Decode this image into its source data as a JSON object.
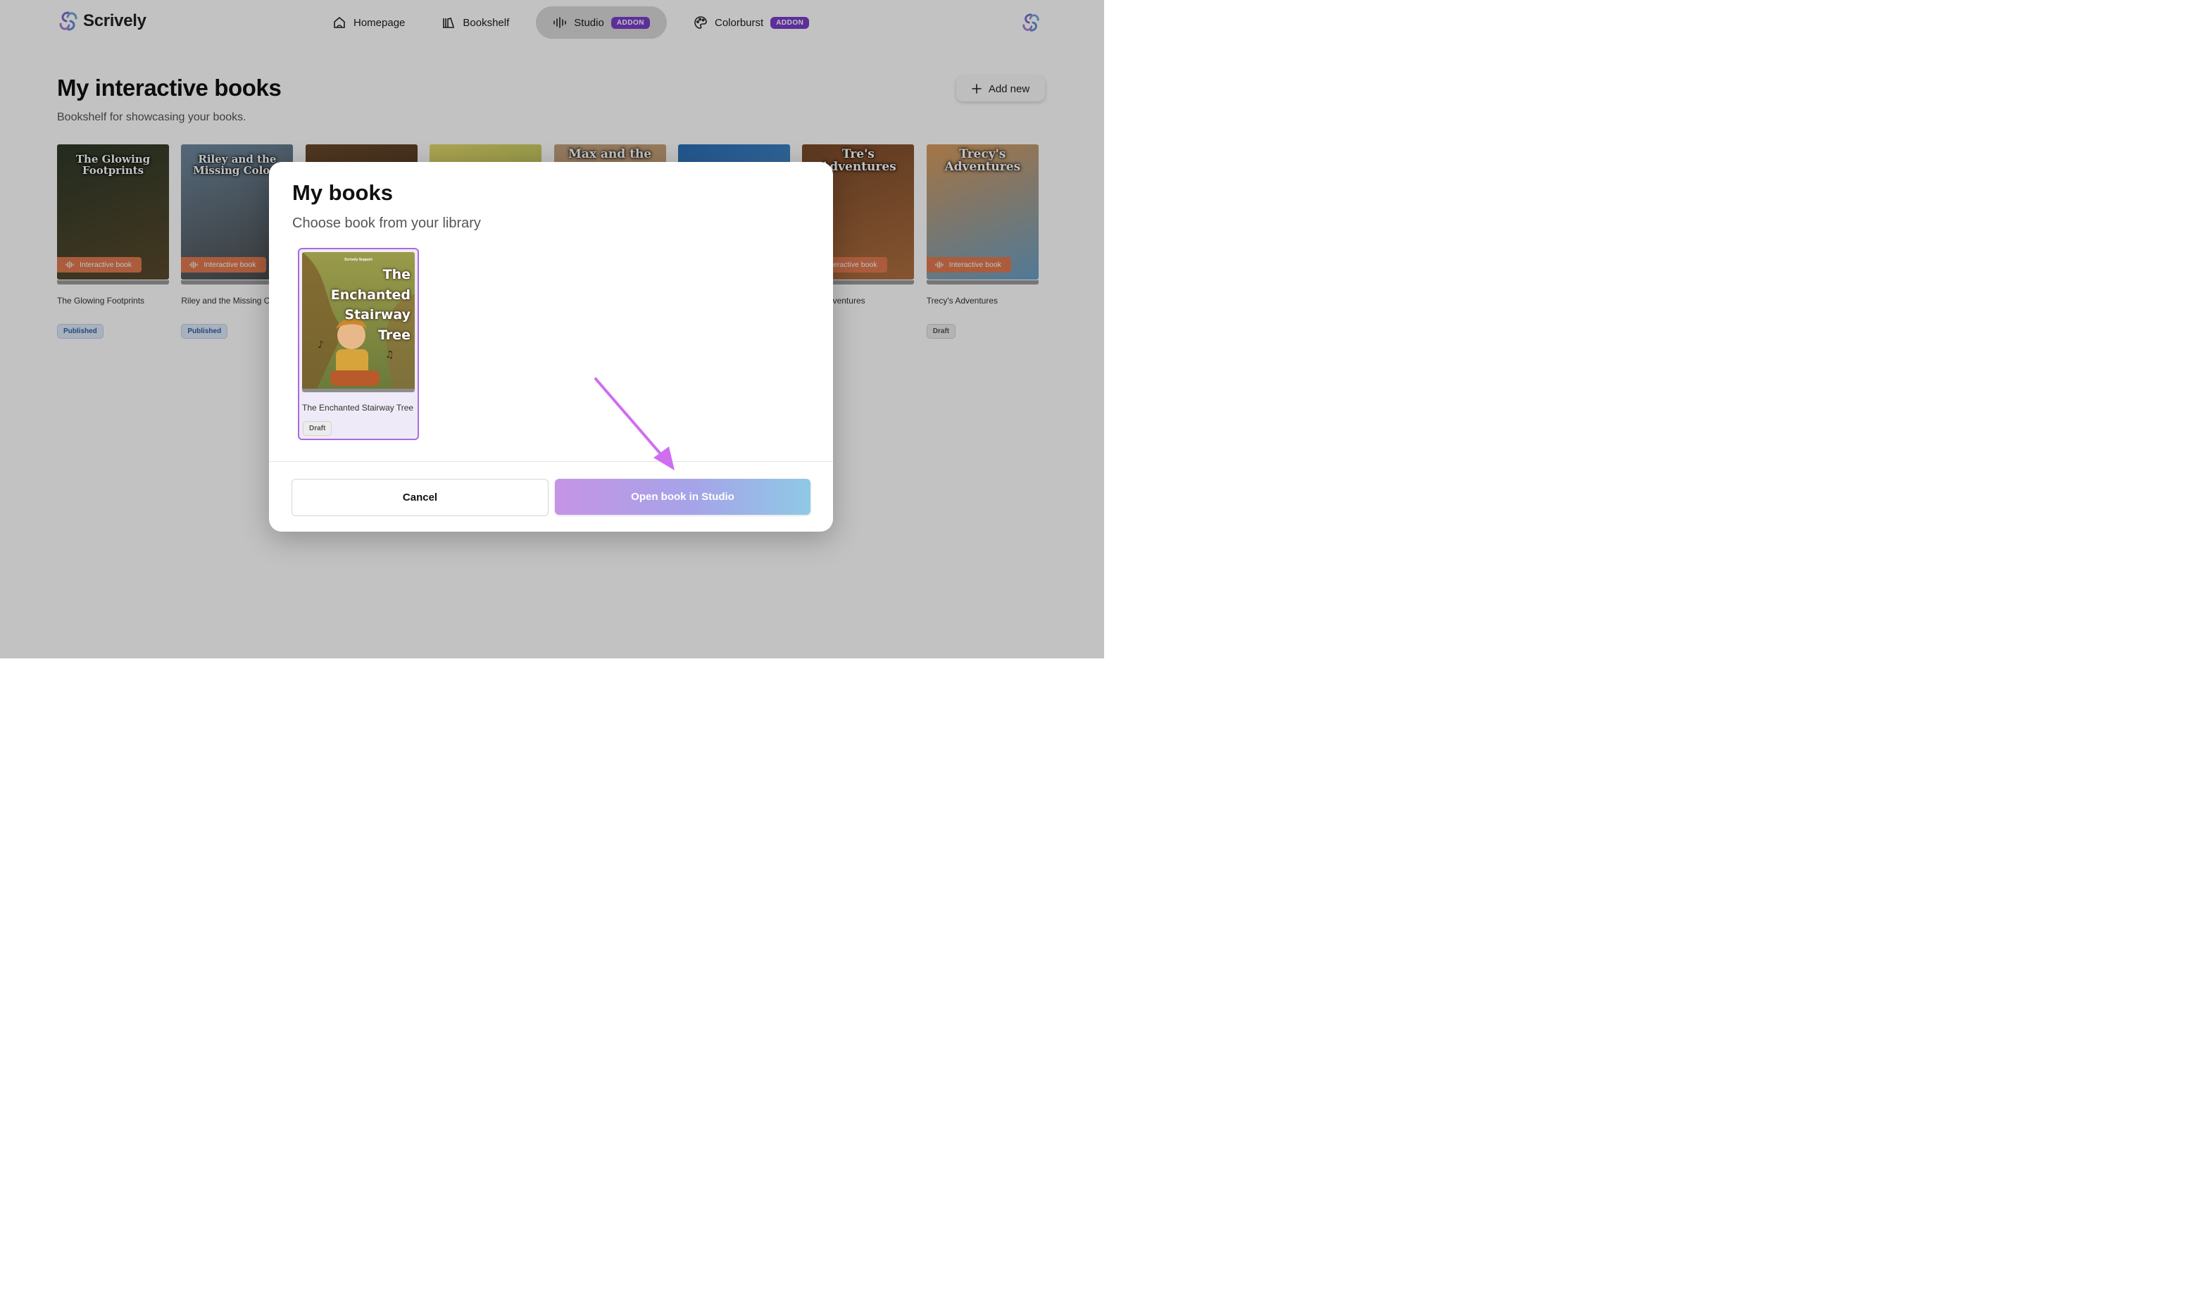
{
  "nav": {
    "brand": "Scrively",
    "items": [
      {
        "label": "Homepage",
        "icon": "home-icon"
      },
      {
        "label": "Bookshelf",
        "icon": "bookshelf-icon"
      },
      {
        "label": "Studio",
        "icon": "soundwave-icon",
        "badge": "ADDON",
        "active": true
      },
      {
        "label": "Colorburst",
        "icon": "palette-icon",
        "badge": "ADDON"
      }
    ]
  },
  "page": {
    "title": "My interactive books",
    "subtitle": "Bookshelf for showcasing your books.",
    "add_label": "Add new"
  },
  "books": [
    {
      "name": "The Glowing Footprints",
      "badge": "Interactive book",
      "status": "Published",
      "cover_text": "The Glowing Footprints",
      "cover_colors": [
        "#2e3a2a",
        "#5a4a2c"
      ]
    },
    {
      "name": "Riley and the Missing Colors",
      "badge": "Interactive book",
      "status": "Published",
      "cover_text": "Riley and the Missing Colors",
      "cover_colors": [
        "#6f8aa0",
        "#4b4b4b"
      ]
    },
    {
      "name": "",
      "badge": "",
      "status": "",
      "cover_text": "",
      "cover_colors": [
        "#6a4a2c",
        "#3d2a1a"
      ]
    },
    {
      "name": "",
      "badge": "",
      "status": "",
      "cover_text": "",
      "cover_colors": [
        "#e2d86b",
        "#8aa84a"
      ]
    },
    {
      "name": "",
      "badge": "",
      "status": "",
      "cover_text": "Max and the",
      "cover_colors": [
        "#c0a080",
        "#d9a465"
      ]
    },
    {
      "name": "",
      "badge": "",
      "status": "",
      "cover_text": "",
      "cover_colors": [
        "#2a6fb8",
        "#6fb3e6"
      ]
    },
    {
      "name": "Tre's Adventures",
      "badge": "Interactive book",
      "status": "",
      "cover_text": "Tre's Adventures",
      "cover_colors": [
        "#7a4a2a",
        "#b07040"
      ]
    },
    {
      "name": "Trecy's Adventures",
      "badge": "Interactive book",
      "status": "Draft",
      "cover_text": "Trecy's Adventures",
      "cover_colors": [
        "#d89a5a",
        "#6aa0c8"
      ]
    }
  ],
  "modal": {
    "title": "My books",
    "subtitle": "Choose book from your library",
    "selected_book": {
      "name": "The Enchanted Stairway Tree",
      "status": "Draft",
      "cover_text": "The Enchanted Stairway Tree",
      "publisher": "Scrively Support"
    },
    "cancel_label": "Cancel",
    "open_label": "Open book in Studio"
  }
}
